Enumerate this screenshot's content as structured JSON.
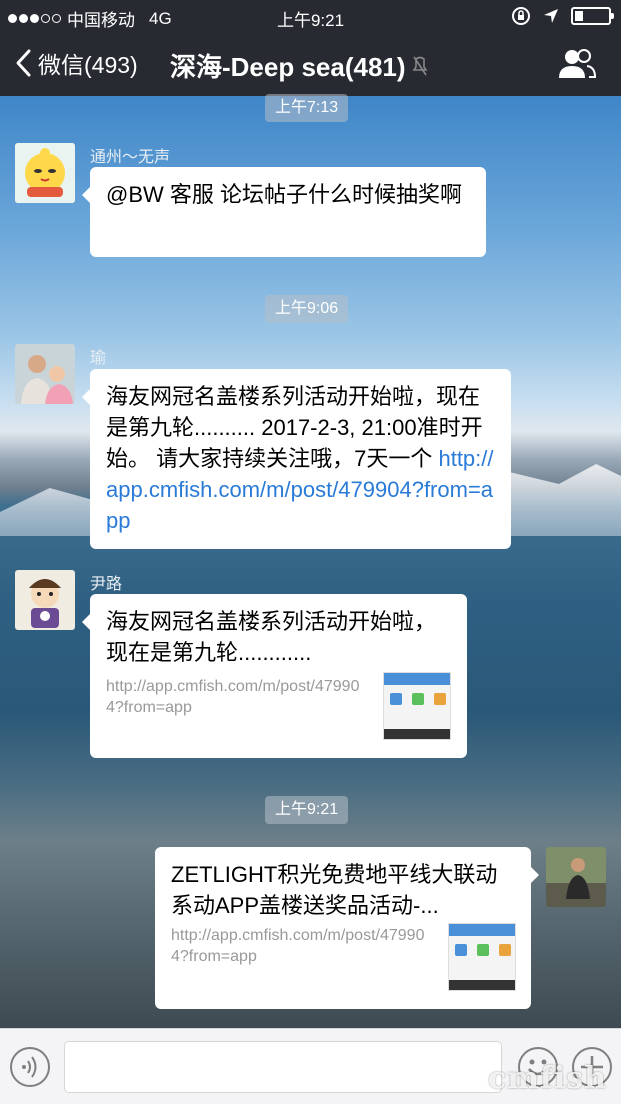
{
  "status_bar": {
    "carrier": "中国移动",
    "network": "4G",
    "time": "上午9:21",
    "battery_level": 0.25
  },
  "nav": {
    "back_label": "微信(493)",
    "title": "深海-Deep sea(481)"
  },
  "time_separators": [
    "上午7:13",
    "上午9:06",
    "上午9:21"
  ],
  "messages": [
    {
      "sender": "通州～无声",
      "text": "@BW 客服 论坛帖子什么时候抽奖啊"
    },
    {
      "sender": "瑜",
      "text": "海友网冠名盖楼系列活动开始啦，现在是第九轮.......... 2017-2-3, 21:00准时开始。 请大家持续关注哦，7天一个 ",
      "link": "http://app.cmfish.com/m/post/479904?from=app"
    },
    {
      "sender": "尹路",
      "card_title": "海友网冠名盖楼系列活动开始啦，现在是第九轮............",
      "card_url": "http://app.cmfish.com/m/post/479904?from=app"
    },
    {
      "sender": "",
      "card_title": "ZETLIGHT积光免费地平线大联动系动APP盖楼送奖品活动-...",
      "card_url": "http://app.cmfish.com/m/post/479904?from=app"
    }
  ],
  "watermark": "cmfish",
  "icons": {
    "back": "chevron-left-icon",
    "mute": "mute-icon",
    "contact": "contacts-icon",
    "voice": "voice-icon",
    "emoji": "emoji-icon",
    "add": "plus-icon"
  }
}
